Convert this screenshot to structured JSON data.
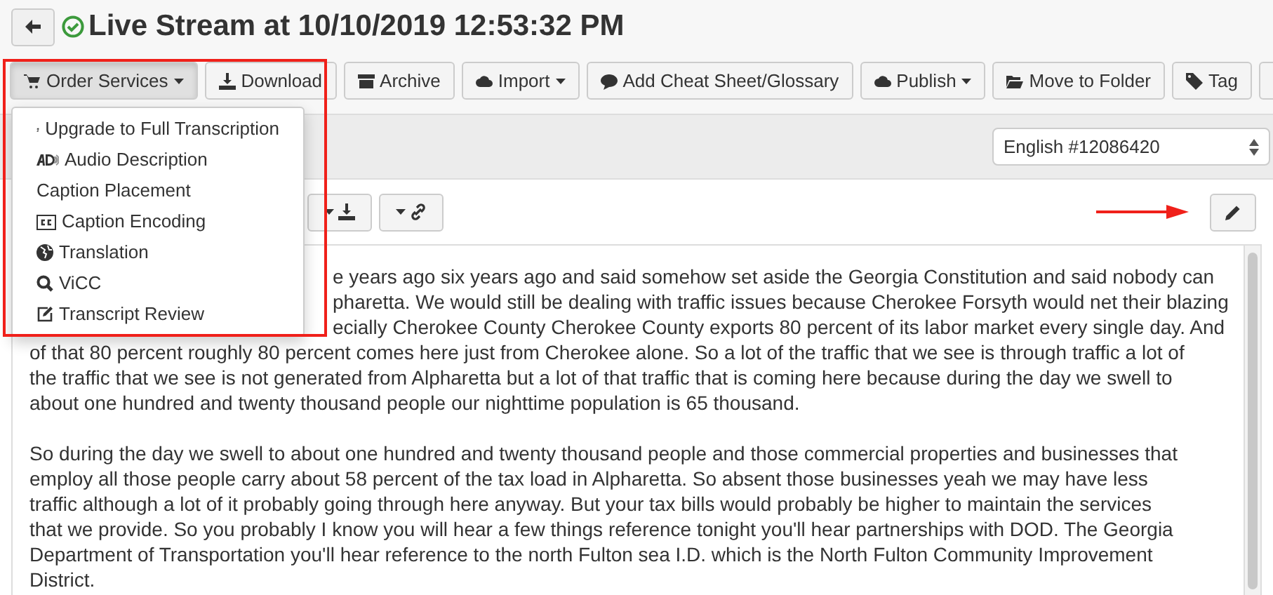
{
  "header": {
    "title": "Live Stream at 10/10/2019 12:53:32 PM"
  },
  "toolbar": [
    {
      "label": "Order Services",
      "caret": true,
      "selected": true
    },
    {
      "label": "Download",
      "caret": false,
      "selected": false
    },
    {
      "label": "Archive",
      "caret": false,
      "selected": false
    },
    {
      "label": "Import",
      "caret": true,
      "selected": false
    },
    {
      "label": "Add Cheat Sheet/Glossary",
      "caret": false,
      "selected": false
    },
    {
      "label": "Publish",
      "caret": true,
      "selected": false
    },
    {
      "label": "Move to Folder",
      "caret": false,
      "selected": false
    },
    {
      "label": "Tag",
      "caret": false,
      "selected": false
    }
  ],
  "menu": [
    {
      "label": "Upgrade to Full Transcription"
    },
    {
      "label": "Audio Description"
    },
    {
      "label": "Caption Placement"
    },
    {
      "label": "Caption Encoding"
    },
    {
      "label": "Translation"
    },
    {
      "label": "ViCC"
    },
    {
      "label": "Transcript Review"
    }
  ],
  "language_select": {
    "value": "English #12086420"
  },
  "transcript": {
    "paragraphs": [
      {
        "lines_beside_menu": [
          "e years ago six years ago and said somehow set aside the Georgia Constitution and said nobody can",
          "pharetta. We would still be dealing with traffic issues because Cherokee Forsyth would net their blazing",
          "ecially Cherokee County Cherokee County exports 80 percent of its labor market every single day. And"
        ],
        "lines": [
          "of that 80 percent roughly 80 percent comes here just from Cherokee alone. So a lot of the traffic that we see is through traffic a lot of",
          "the traffic that we see is not generated from Alpharetta but a lot of that traffic that is coming here because during the day we swell to",
          "about one hundred and twenty thousand people our nighttime population is 65 thousand."
        ]
      },
      {
        "lines": [
          "So during the day we swell to about one hundred and twenty thousand people and those commercial properties and businesses that",
          "employ all those people carry about 58 percent of the tax load in Alpharetta. So absent those businesses yeah we may have less",
          "traffic although a lot of it probably going through here anyway. But your tax bills would probably be higher to maintain the services",
          "that we provide. So you probably I know you will hear a few things reference tonight you'll hear partnerships with DOD. The Georgia",
          "Department of Transportation you'll hear reference to the north Fulton sea I.D. which is the North Fulton Community Improvement",
          "District."
        ]
      }
    ]
  }
}
